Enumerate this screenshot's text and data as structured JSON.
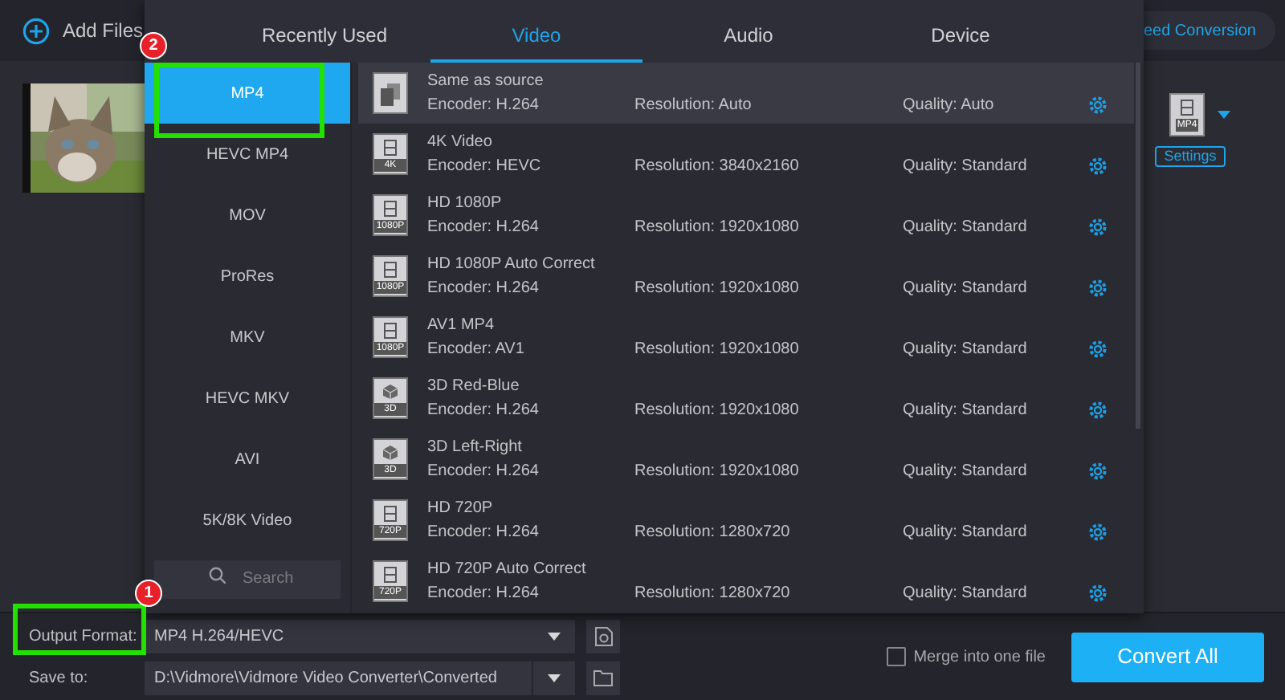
{
  "toolbar": {
    "add_files": "Add Files",
    "speed_conversion": "eed Conversion"
  },
  "file_item": {
    "format_badge": "MP4",
    "settings": "Settings"
  },
  "format_popup": {
    "tabs": [
      {
        "label": "Recently Used",
        "selected": false
      },
      {
        "label": "Video",
        "selected": true
      },
      {
        "label": "Audio",
        "selected": false
      },
      {
        "label": "Device",
        "selected": false
      }
    ],
    "categories": [
      {
        "label": "MP4",
        "selected": true
      },
      {
        "label": "HEVC MP4",
        "selected": false
      },
      {
        "label": "MOV",
        "selected": false
      },
      {
        "label": "ProRes",
        "selected": false
      },
      {
        "label": "MKV",
        "selected": false
      },
      {
        "label": "HEVC MKV",
        "selected": false
      },
      {
        "label": "AVI",
        "selected": false
      },
      {
        "label": "5K/8K Video",
        "selected": false
      }
    ],
    "search": {
      "placeholder": "Search"
    },
    "presets": [
      {
        "kind": "copy",
        "name": "Same as source",
        "encoder": "Encoder: H.264",
        "resolution": "Resolution: Auto",
        "quality": "Quality: Auto",
        "selected": true
      },
      {
        "kind": "film",
        "badge": "4K",
        "name": "4K Video",
        "encoder": "Encoder: HEVC",
        "resolution": "Resolution: 3840x2160",
        "quality": "Quality: Standard",
        "selected": false
      },
      {
        "kind": "film",
        "badge": "1080P",
        "name": "HD 1080P",
        "encoder": "Encoder: H.264",
        "resolution": "Resolution: 1920x1080",
        "quality": "Quality: Standard",
        "selected": false
      },
      {
        "kind": "film",
        "badge": "1080P",
        "name": "HD 1080P Auto Correct",
        "encoder": "Encoder: H.264",
        "resolution": "Resolution: 1920x1080",
        "quality": "Quality: Standard",
        "selected": false
      },
      {
        "kind": "film",
        "badge": "1080P",
        "name": "AV1 MP4",
        "encoder": "Encoder: AV1",
        "resolution": "Resolution: 1920x1080",
        "quality": "Quality: Standard",
        "selected": false
      },
      {
        "kind": "cube",
        "badge": "3D",
        "name": "3D Red-Blue",
        "encoder": "Encoder: H.264",
        "resolution": "Resolution: 1920x1080",
        "quality": "Quality: Standard",
        "selected": false
      },
      {
        "kind": "cube",
        "badge": "3D",
        "name": "3D Left-Right",
        "encoder": "Encoder: H.264",
        "resolution": "Resolution: 1920x1080",
        "quality": "Quality: Standard",
        "selected": false
      },
      {
        "kind": "film",
        "badge": "720P",
        "name": "HD 720P",
        "encoder": "Encoder: H.264",
        "resolution": "Resolution: 1280x720",
        "quality": "Quality: Standard",
        "selected": false
      },
      {
        "kind": "film",
        "badge": "720P",
        "name": "HD 720P Auto Correct",
        "encoder": "Encoder: H.264",
        "resolution": "Resolution: 1280x720",
        "quality": "Quality: Standard",
        "selected": false
      }
    ]
  },
  "bottom_bar": {
    "output_format_label": "Output Format:",
    "output_format_value": "MP4 H.264/HEVC",
    "save_to_label": "Save to:",
    "save_to_value": "D:\\Vidmore\\Vidmore Video Converter\\Converted",
    "merge": {
      "label": "Merge into one file",
      "checked": false
    },
    "convert_all": "Convert All"
  },
  "annotations": [
    {
      "number": "1"
    },
    {
      "number": "2"
    }
  ]
}
